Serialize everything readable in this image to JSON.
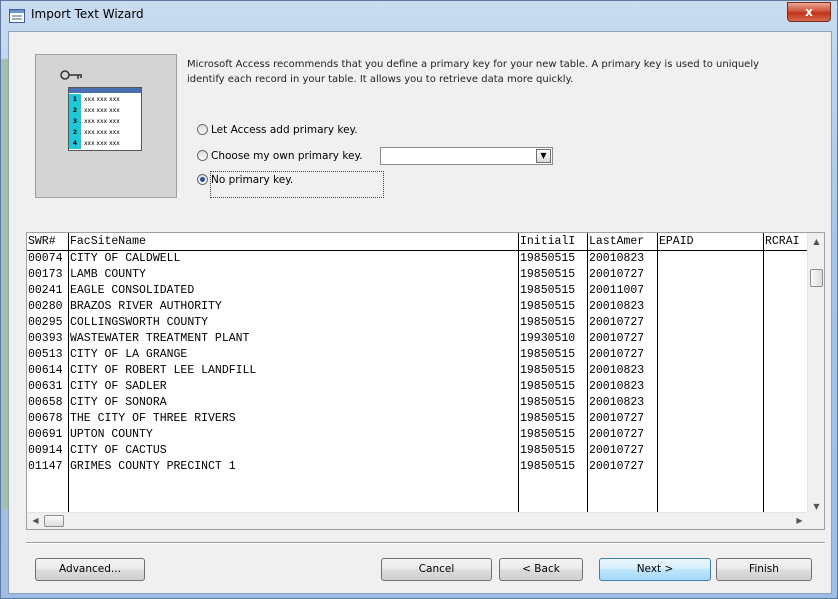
{
  "window": {
    "title": "Import Text Wizard",
    "close_label": "x"
  },
  "intro_text": "Microsoft Access recommends that you define a primary key for your new table. A primary key is used to uniquely identify each record in your table. It allows you to retrieve data more quickly.",
  "illustration": {
    "rows": [
      {
        "num": "1",
        "text": "xxx xxx xxx"
      },
      {
        "num": "2",
        "text": "xxx xxx xxx"
      },
      {
        "num": "3",
        "text": "xxx xxx xxx"
      },
      {
        "num": "2",
        "text": "xxx xxx xxx"
      },
      {
        "num": "4",
        "text": "xxx xxx xxx"
      }
    ]
  },
  "options": {
    "let_access": "Let Access add primary key.",
    "choose_own": "Choose my own primary key.",
    "no_key": "No primary key.",
    "selected": "no_key",
    "key_field_value": ""
  },
  "grid": {
    "columns": [
      "SWR#",
      "FacSiteName",
      "InitialI",
      "LastAmer",
      "EPAID",
      "RCRAI"
    ],
    "rows": [
      [
        "00074",
        "CITY OF CALDWELL",
        "19850515",
        "20010823",
        "",
        ""
      ],
      [
        "00173",
        "LAMB COUNTY",
        "19850515",
        "20010727",
        "",
        ""
      ],
      [
        "00241",
        "EAGLE CONSOLIDATED",
        "19850515",
        "20011007",
        "",
        ""
      ],
      [
        "00280",
        "BRAZOS RIVER AUTHORITY",
        "19850515",
        "20010823",
        "",
        ""
      ],
      [
        "00295",
        "COLLINGSWORTH COUNTY",
        "19850515",
        "20010727",
        "",
        ""
      ],
      [
        "00393",
        "WASTEWATER TREATMENT PLANT",
        "19930510",
        "20010727",
        "",
        ""
      ],
      [
        "00513",
        "CITY OF LA GRANGE",
        "19850515",
        "20010727",
        "",
        ""
      ],
      [
        "00614",
        "CITY OF ROBERT LEE LANDFILL",
        "19850515",
        "20010823",
        "",
        ""
      ],
      [
        "00631",
        "CITY OF SADLER",
        "19850515",
        "20010823",
        "",
        ""
      ],
      [
        "00658",
        "CITY OF SONORA",
        "19850515",
        "20010823",
        "",
        ""
      ],
      [
        "00678",
        "THE CITY OF THREE RIVERS",
        "19850515",
        "20010727",
        "",
        ""
      ],
      [
        "00691",
        "UPTON COUNTY",
        "19850515",
        "20010727",
        "",
        ""
      ],
      [
        "00914",
        "CITY OF CACTUS",
        "19850515",
        "20010727",
        "",
        ""
      ],
      [
        "01147",
        "GRIMES COUNTY PRECINCT 1",
        "19850515",
        "20010727",
        "",
        ""
      ]
    ]
  },
  "buttons": {
    "advanced": "Advanced...",
    "cancel": "Cancel",
    "back": "< Back",
    "next": "Next >",
    "finish": "Finish"
  },
  "icons": {
    "title": "wizard-icon",
    "key": "key-icon"
  }
}
